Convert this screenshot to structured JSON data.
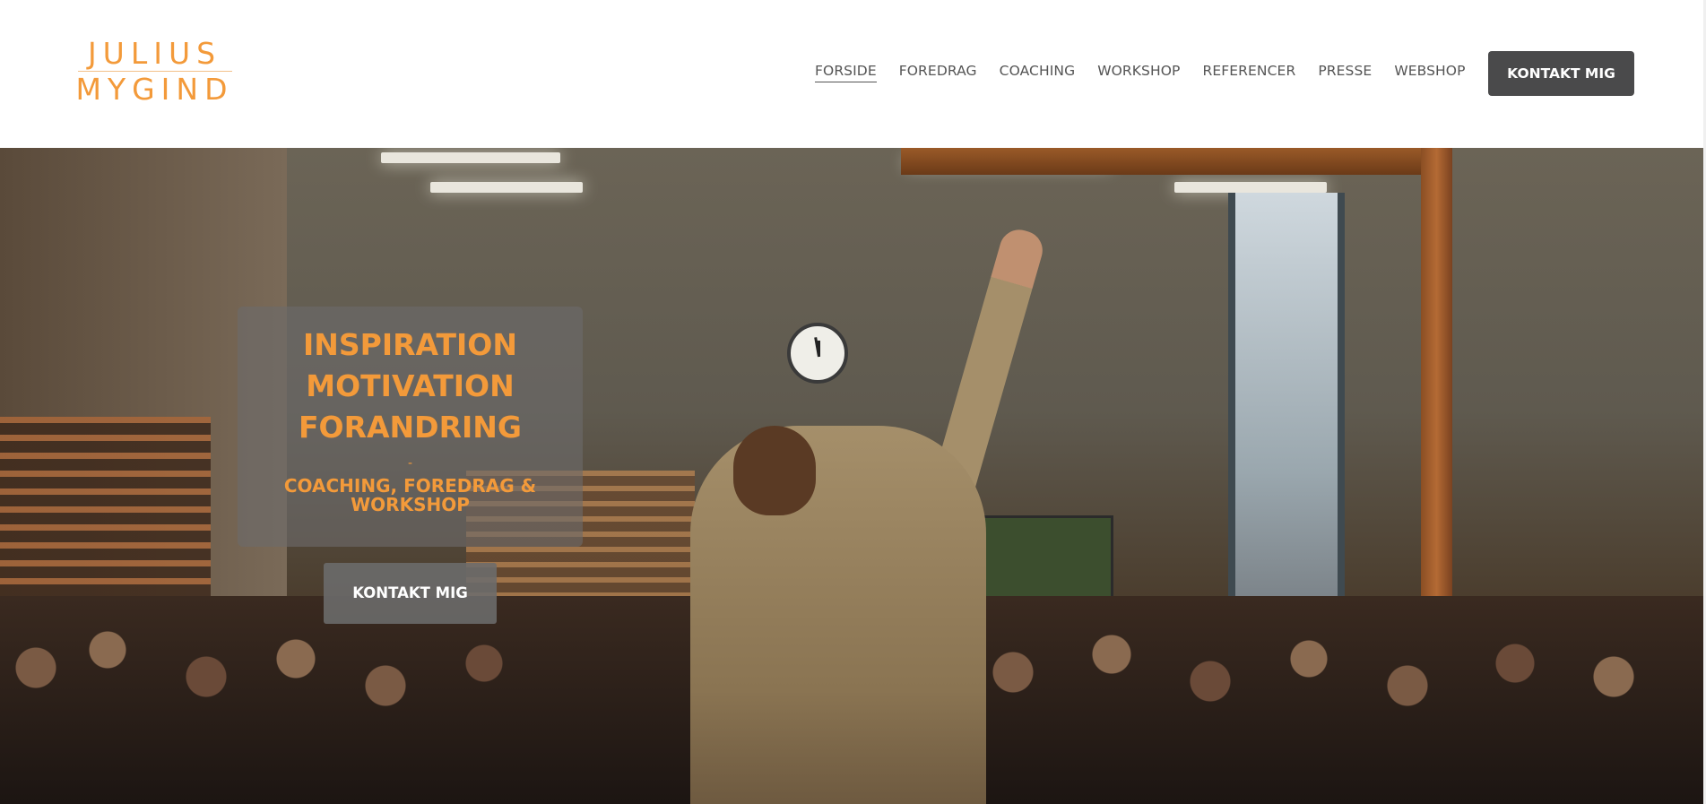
{
  "logo": {
    "line1": "JULIUS",
    "line2": "MYGIND"
  },
  "nav": {
    "items": [
      {
        "label": "FORSIDE",
        "active": true
      },
      {
        "label": "FOREDRAG",
        "active": false
      },
      {
        "label": "COACHING",
        "active": false
      },
      {
        "label": "WORKSHOP",
        "active": false
      },
      {
        "label": "REFERENCER",
        "active": false
      },
      {
        "label": "PRESSE",
        "active": false
      },
      {
        "label": "WEBSHOP",
        "active": false
      }
    ],
    "cta_label": "KONTAKT MIG"
  },
  "hero": {
    "headline_1": "INSPIRATION",
    "headline_2": "MOTIVATION",
    "headline_3": "FORANDRING",
    "separator": "-",
    "subtitle": "COACHING, FOREDRAG & WORKSHOP",
    "cta_label": "KONTAKT MIG",
    "image": "speaker-with-raised-arm-before-student-audience-in-gym"
  },
  "colors": {
    "accent": "#f39a3a",
    "button_dark": "#4a4a4b",
    "nav_text": "#555555",
    "overlay": "rgba(108,106,106,0.62)"
  }
}
